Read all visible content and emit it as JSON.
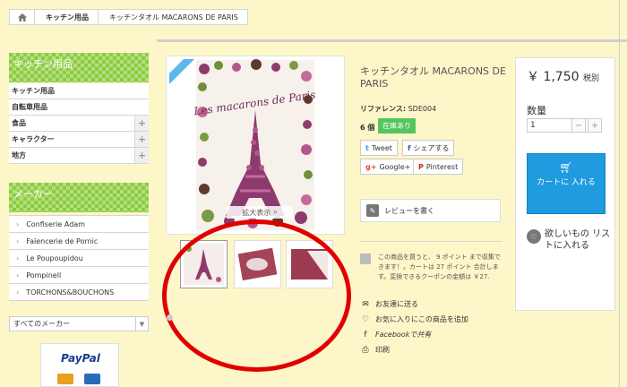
{
  "breadcrumb": {
    "home_icon": "home-icon",
    "items": [
      "キッチン用品",
      "キッチンタオル MACARONS DE PARIS"
    ]
  },
  "categories": {
    "title": "キッチン用品",
    "items": [
      {
        "label": "キッチン用品",
        "expand": ""
      },
      {
        "label": "自転車用品",
        "expand": ""
      },
      {
        "label": "食品",
        "expand": "+"
      },
      {
        "label": "キャラクター",
        "expand": "+"
      },
      {
        "label": "地方",
        "expand": "+"
      }
    ]
  },
  "makers": {
    "title": "メーカー",
    "items": [
      "Confiserie Adam",
      "Faïencerie de Pornic",
      "Le Poupoupidou",
      "Pompinell",
      "TORCHONS&BOUCHONS"
    ],
    "arrow": "›",
    "select_value": "すべてのメーカー"
  },
  "paypal": {
    "logo_text": "PayPal"
  },
  "product": {
    "image_text": "Les macarons de Paris",
    "zoom_label": "拡大表示",
    "title": "キッチンタオル MACARONS DE PARIS",
    "reference_label": "リファレンス:",
    "reference_value": "SDE004",
    "quantity_text": "6 個",
    "stock_badge": "在庫あり",
    "share": {
      "tweet": "Tweet",
      "facebook": "シェアする",
      "google": "Google+",
      "pinterest": "Pinterest"
    },
    "review_label": "レビューを書く",
    "points_text": "この商品を買うと、 9 ポイント まで収集できます！。カートは 27 ポイント 合計します。変換できるクーポンの金額は ￥27.",
    "links": {
      "send": "お友達に送る",
      "favorite": "お気に入りにこの商品を追加",
      "facebook_share": "Facebookで共有",
      "print": "印刷"
    }
  },
  "pricebox": {
    "price": "￥ 1,750",
    "tax": "税別",
    "qty_label": "数量",
    "qty_value": "1",
    "minus": "−",
    "plus": "+",
    "cart_label": "カートに 入れる",
    "wishlist_label": "欲しいもの リストに入れる"
  },
  "colors": {
    "accent_green": "#8ccc3f",
    "stock_green": "#55c65e",
    "cart_blue": "#1f9be0",
    "annotation_red": "#e00000",
    "background": "#fdf6c9"
  }
}
